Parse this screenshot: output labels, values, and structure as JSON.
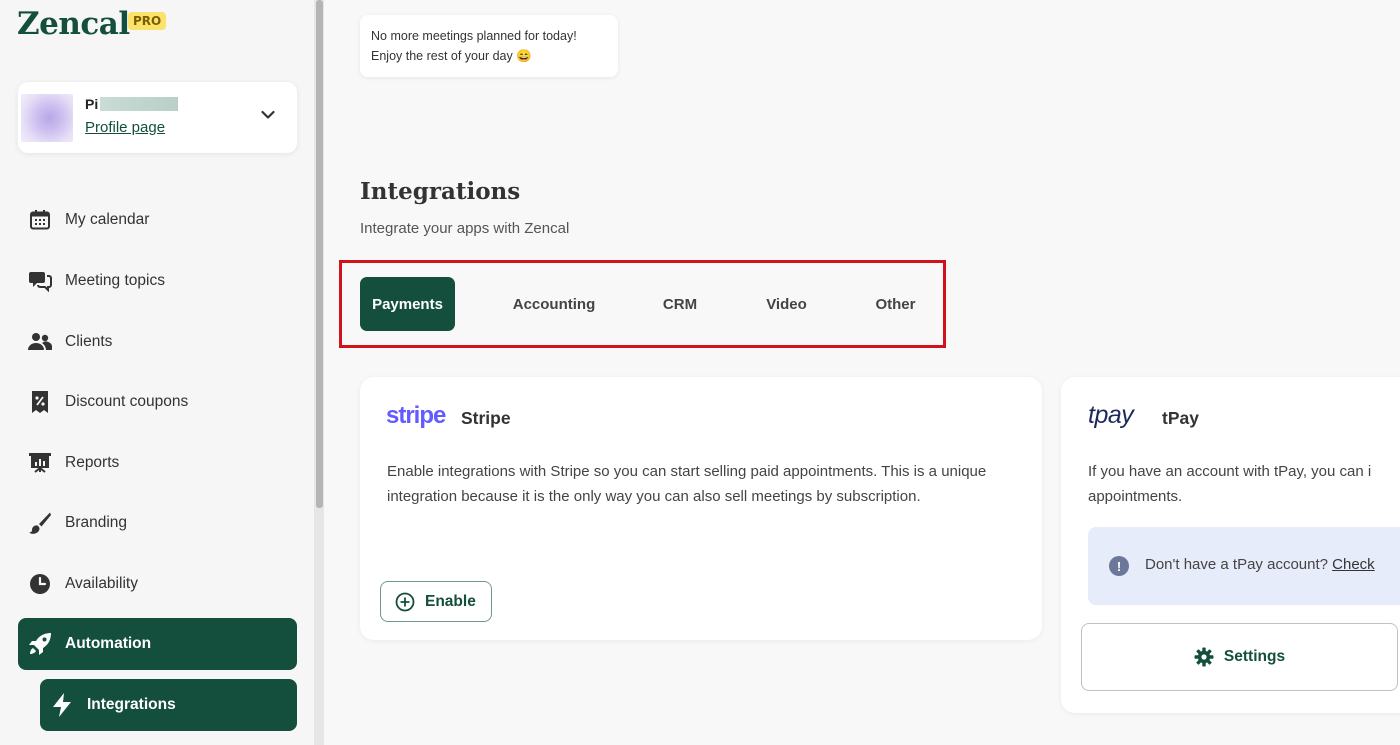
{
  "app": {
    "logo_text": "Zencal",
    "plan_badge": "PRO"
  },
  "profile": {
    "name": "Pi",
    "link_label": "Profile page"
  },
  "sidebar": {
    "items": [
      {
        "label": "My calendar",
        "icon": "calendar-icon"
      },
      {
        "label": "Meeting topics",
        "icon": "chat-bubbles-icon"
      },
      {
        "label": "Clients",
        "icon": "users-icon"
      },
      {
        "label": "Discount coupons",
        "icon": "coupon-icon"
      },
      {
        "label": "Reports",
        "icon": "presentation-chart-icon"
      },
      {
        "label": "Branding",
        "icon": "paintbrush-icon"
      },
      {
        "label": "Availability",
        "icon": "clock-icon"
      },
      {
        "label": "Automation",
        "icon": "rocket-icon",
        "active": true
      },
      {
        "label": "Integrations",
        "icon": "bolt-icon",
        "active": true,
        "sub": true
      }
    ]
  },
  "toast": {
    "line1": "No more meetings planned for today!",
    "line2": "Enjoy the rest of your day 😄"
  },
  "page": {
    "title": "Integrations",
    "subtitle": "Integrate your apps with Zencal"
  },
  "tabs": [
    {
      "label": "Payments",
      "active": true
    },
    {
      "label": "Accounting"
    },
    {
      "label": "CRM"
    },
    {
      "label": "Video"
    },
    {
      "label": "Other"
    }
  ],
  "cards": {
    "stripe": {
      "logo": "stripe",
      "title": "Stripe",
      "description": "Enable integrations with Stripe so you can start selling paid appointments. This is a unique integration because it is the only way you can also sell meetings by subscription.",
      "button_label": "Enable"
    },
    "tpay": {
      "logo": "tpay",
      "title": "tPay",
      "description": "If you have an account with tPay, you can i appointments.",
      "info_text": "Don't have a tPay account?",
      "info_link": "Check",
      "button_label": "Settings"
    }
  },
  "colors": {
    "brand": "#134f3c",
    "highlight_outline": "#d0121b",
    "stripe": "#635bff",
    "tpay": "#1c2b5a"
  }
}
